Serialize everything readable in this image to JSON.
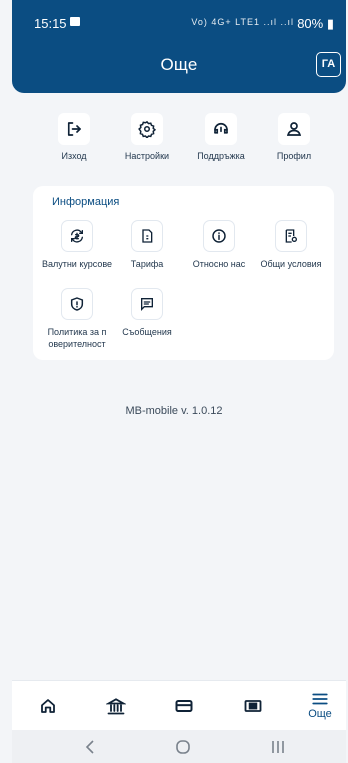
{
  "status": {
    "time": "15:15",
    "battery": "80%",
    "signal": "Vo) 4G+ LTE1 ..ıl ..ıl"
  },
  "header": {
    "title": "Още",
    "avatar": "ГА"
  },
  "quick_actions": [
    {
      "label": "Изход",
      "icon": "logout-icon"
    },
    {
      "label": "Настройки",
      "icon": "gear-icon"
    },
    {
      "label": "Поддръжка",
      "icon": "headset-icon"
    },
    {
      "label": "Профил",
      "icon": "user-icon"
    }
  ],
  "info": {
    "title": "Информация",
    "items": [
      {
        "label": "Валутни курсове",
        "icon": "currency-exchange-icon"
      },
      {
        "label": "Тарифа",
        "icon": "document-icon"
      },
      {
        "label": "Относно нас",
        "icon": "info-icon"
      },
      {
        "label": "Общи условия",
        "icon": "terms-icon"
      },
      {
        "label": "Политика за п оверителност",
        "icon": "shield-icon"
      },
      {
        "label": "Съобщения",
        "icon": "message-icon"
      }
    ]
  },
  "version": "MB-mobile v. 1.0.12",
  "bottom_nav": {
    "more_label": "Още"
  },
  "colors": {
    "primary": "#0b4d82",
    "background": "#f3f5f8"
  }
}
